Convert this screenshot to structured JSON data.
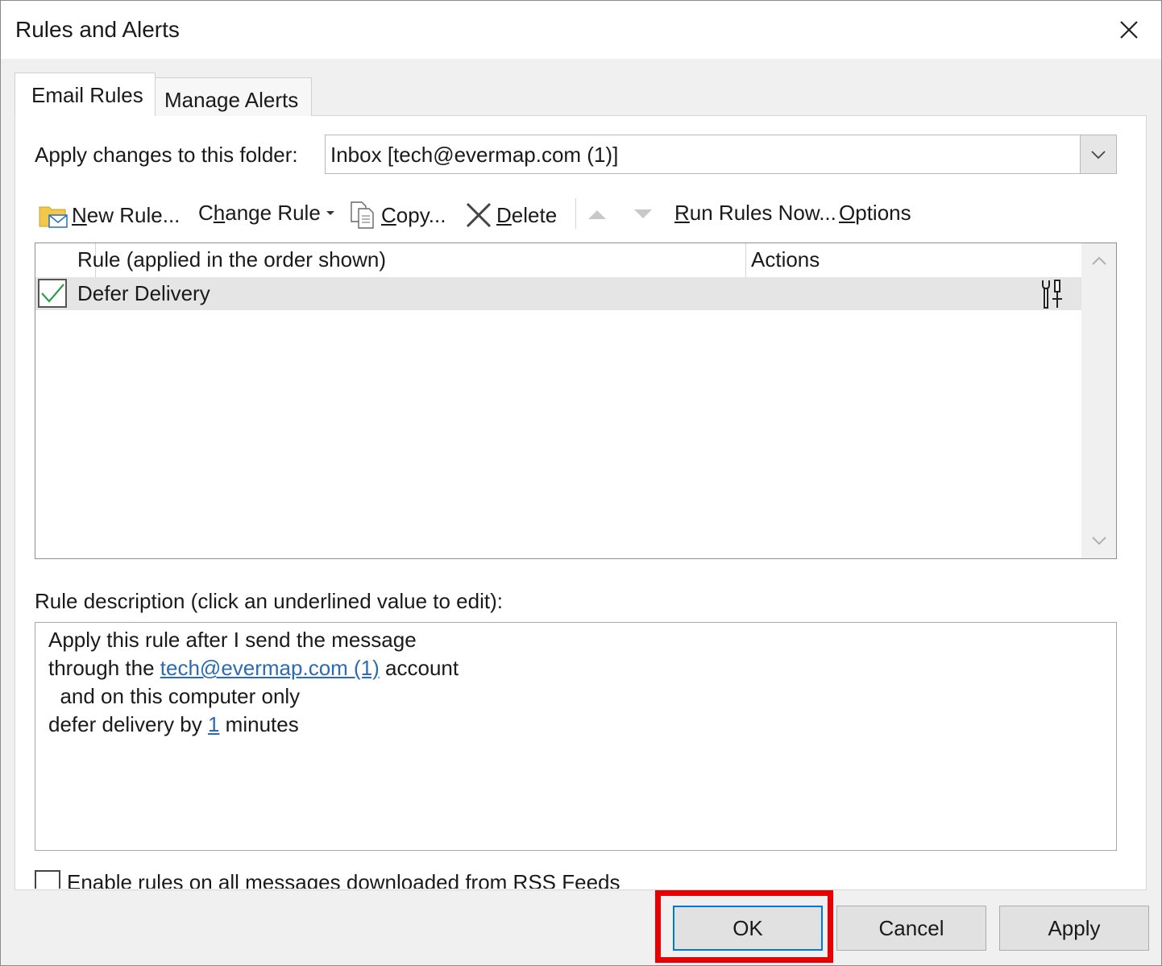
{
  "window": {
    "title": "Rules and Alerts",
    "close_glyph": "✕"
  },
  "tabs": [
    {
      "label": "Email Rules",
      "active": true
    },
    {
      "label": "Manage Alerts",
      "active": false
    }
  ],
  "folder": {
    "label": "Apply changes to this folder:",
    "value": "Inbox [tech@evermap.com (1)]"
  },
  "toolbar": {
    "new_rule": {
      "u": "N",
      "rest": "ew Rule..."
    },
    "change_rule": {
      "pre": "C",
      "u": "h",
      "rest": "ange Rule"
    },
    "copy": {
      "u": "C",
      "rest": "opy..."
    },
    "delete": {
      "u": "D",
      "rest": "elete"
    },
    "run_rules": {
      "u": "R",
      "rest": "un Rules Now..."
    },
    "options": {
      "u": "O",
      "rest": "ptions"
    }
  },
  "rules_list": {
    "columns": [
      "Rule (applied in the order shown)",
      "Actions"
    ],
    "rows": [
      {
        "name": "Defer Delivery",
        "checked": true
      }
    ]
  },
  "description": {
    "label": "Rule description (click an underlined value to edit):",
    "line1": "Apply this rule after I send the message",
    "line2_pre": "through the ",
    "line2_link": "tech@evermap.com (1)",
    "line2_post": " account",
    "line3": "  and on this computer only",
    "line4_pre": "defer delivery by ",
    "line4_link": "1",
    "line4_post": " minutes"
  },
  "rss": {
    "label": "Enable rules on all messages downloaded from RSS Feeds",
    "checked": false
  },
  "buttons": {
    "ok": "OK",
    "cancel": "Cancel",
    "apply": "Apply"
  },
  "colors": {
    "accent": "#0078d7",
    "link": "#2c6ab2",
    "highlight": "#e60000",
    "check": "#2e9d4a"
  }
}
